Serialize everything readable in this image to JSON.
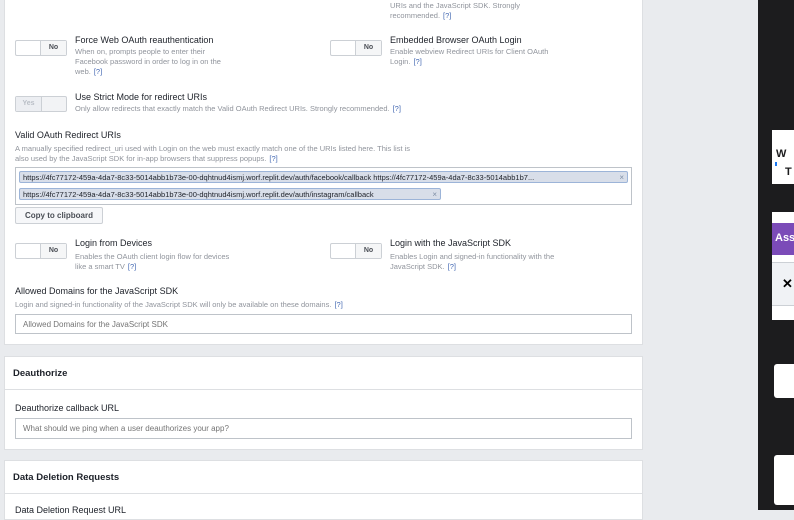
{
  "options": {
    "force_reauth": {
      "title": "Force Web OAuth reauthentication",
      "desc": "When on, prompts people to enter their Facebook password in order to log in on the web.",
      "help": "[?]",
      "toggle": "No"
    },
    "embedded_browser": {
      "title": "Embedded Browser OAuth Login",
      "desc": "Enable webview Redirect URIs for Client OAuth Login.",
      "help": "[?]",
      "toggle": "No"
    },
    "top_note": {
      "desc": "URIs and the JavaScript SDK. Strongly recommended.",
      "help": "[?]"
    },
    "strict_mode": {
      "title": "Use Strict Mode for redirect URIs",
      "desc": "Only allow redirects that exactly match the Valid OAuth Redirect URIs. Strongly recommended.",
      "help": "[?]",
      "toggle": "Yes"
    },
    "login_devices": {
      "title": "Login from Devices",
      "desc": "Enables the OAuth client login flow for devices like a smart TV",
      "help": "[?]",
      "toggle": "No"
    },
    "login_js_sdk": {
      "title": "Login with the JavaScript SDK",
      "desc": "Enables Login and signed-in functionality with the JavaScript SDK.",
      "help": "[?]",
      "toggle": "No"
    }
  },
  "redirect_uris": {
    "label": "Valid OAuth Redirect URIs",
    "hint": "A manually specified redirect_uri used with Login on the web must exactly match one of the URIs listed here. This list is also used by the JavaScript SDK for in-app browsers that suppress popups.",
    "help": "[?]",
    "tags": [
      "https://4fc77172-459a-4da7-8c33-5014abb1b73e-00-dqhtnud4ismj.worf.replit.dev/auth/facebook/callback https://4fc77172-459a-4da7-8c33-5014abb1b7...",
      "https://4fc77172-459a-4da7-8c33-5014abb1b73e-00-dqhtnud4ismj.worf.replit.dev/auth/instagram/callback"
    ],
    "remove_glyph": "×",
    "copy_button": "Copy to clipboard"
  },
  "allowed_domains": {
    "label": "Allowed Domains for the JavaScript SDK",
    "hint": "Login and signed-in functionality of the JavaScript SDK will only be available on these domains.",
    "help": "[?]",
    "placeholder": "Allowed Domains for the JavaScript SDK"
  },
  "deauthorize": {
    "header": "Deauthorize",
    "label": "Deauthorize callback URL",
    "placeholder": "What should we ping when a user deauthorizes your app?"
  },
  "data_deletion": {
    "header": "Data Deletion Requests",
    "label": "Data Deletion Request URL"
  },
  "colors": {
    "link": "#4267b2",
    "tag_bg": "#d8dee9",
    "page_bg": "#e9ebee"
  }
}
